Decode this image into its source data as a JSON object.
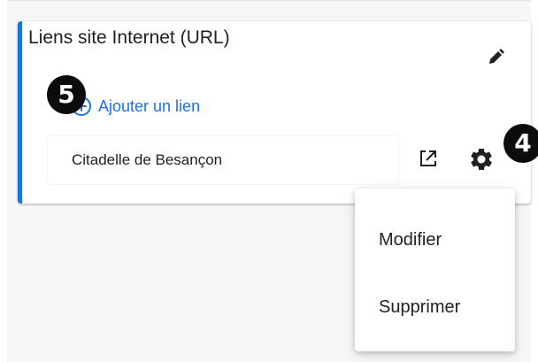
{
  "card": {
    "title": "Liens site Internet (URL)",
    "accent_color": "#1a73e8"
  },
  "add_link": {
    "label": "Ajouter un lien",
    "color": "#1a73e8"
  },
  "links": [
    {
      "label": "Citadelle de Besançon"
    }
  ],
  "menu": {
    "items": [
      {
        "label": "Modifier"
      },
      {
        "label": "Supprimer"
      }
    ]
  },
  "annotations": {
    "badge_5": "5",
    "badge_4": "4"
  },
  "icons": {
    "edit": "pencil-icon",
    "add": "plus-circle-icon",
    "open": "open-in-new-icon",
    "settings": "gear-icon"
  }
}
